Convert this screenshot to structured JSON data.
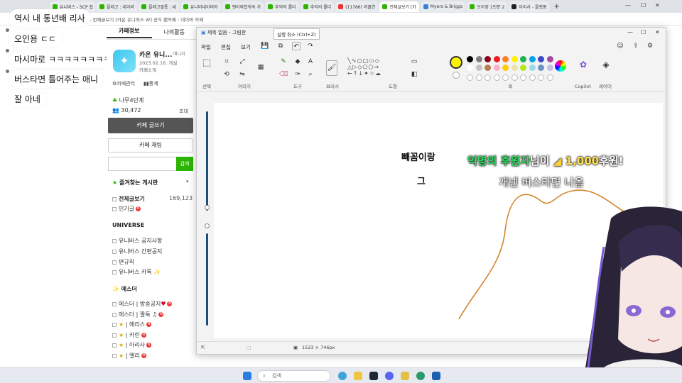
{
  "browser": {
    "tabs": [
      {
        "label": "유니버스 - SCP 잡",
        "icon": "naver-cafe-icon"
      },
      {
        "label": "플레고 : 네이버",
        "icon": "naver-cafe-icon"
      },
      {
        "label": "플레고필통 : 네",
        "icon": "naver-cafe-icon"
      },
      {
        "label": "유니버네이버의",
        "icon": "naver-cafe-icon"
      },
      {
        "label": "멘아와합작속 가",
        "icon": "naver-cafe-icon"
      },
      {
        "label": "추억의 롤더",
        "icon": "naver-cafe-icon"
      },
      {
        "label": "추억의 롤더",
        "icon": "naver-cafe-icon"
      },
      {
        "label": "(11766) 과몰연",
        "icon": "youtube-icon"
      },
      {
        "label": "전체글보기 [카",
        "icon": "naver-cafe-icon",
        "active": true
      },
      {
        "label": "Myers & Briggs",
        "icon": "globe-icon"
      },
      {
        "label": "오아정 1인분 2",
        "icon": "naver-cafe-icon"
      },
      {
        "label": "아리사 - 플랫폼",
        "icon": "chat-icon"
      }
    ],
    "address": "om 전체글보기 [카온 유니버스 W] 공식 팬카페 : 네이버 카페"
  },
  "chat": {
    "messages": [
      "역시 내 통년배 리사",
      "오인용 ㄷㄷ",
      "마시마로 ㅋㅋㅋㅋㅋㅋㅋㅋㅋ",
      "버스타면 틀어주는 애니",
      "잘 아네"
    ]
  },
  "cafe": {
    "tabs": [
      "카페정보",
      "나의활동"
    ],
    "name": "카온 유니...",
    "manager": "매니저",
    "date": "2023.02.16. 개설",
    "intro": "카페소개",
    "manage": "카페관리",
    "stats": "통계",
    "level": "나무4단계",
    "members": "30,472",
    "invite": "초대",
    "write_button": "카페 글쓰기",
    "chat_button": "카페 채팅",
    "search_button": "검색",
    "fav_header": "즐겨찾는 게시판",
    "all_posts": "전체글보기",
    "all_count": "169,123",
    "popular": "인기글",
    "universe_header": "UNIVERSE",
    "universe_items": [
      "유니버스 공지사항",
      "유니버스 간편공지",
      "편규칙",
      "유니버스 카톡"
    ],
    "esther_header": "에스더",
    "esther_items": [
      "에스더 | 방송공지",
      "에스더 | 짤툭",
      "| 에리스",
      "| 카린",
      "| 아리사",
      "| 엘리"
    ]
  },
  "paint": {
    "title": "제목 없음 - 그림판",
    "tooltip": "실행 취소 (Ctrl+Z)",
    "menu": [
      "파일",
      "편집",
      "보기"
    ],
    "groups": [
      "선택",
      "이미지",
      "도구",
      "브러시",
      "도형",
      "색",
      "Copilot",
      "레이어"
    ],
    "canvas_texts": [
      "빼꼼이랑",
      "그"
    ],
    "status_size": "1523 × 746px",
    "palette": [
      "#000000",
      "#7f7f7f",
      "#880015",
      "#ed1c24",
      "#ff7f27",
      "#fff200",
      "#22b14c",
      "#00a2e8",
      "#3f48cc",
      "#a349a4",
      "#ffffff",
      "#c3c3c3",
      "#b97a57",
      "#ffaec9",
      "#ffc90e",
      "#efe4b0",
      "#b5e61d",
      "#99d9ea",
      "#7092be",
      "#c8bfe7"
    ],
    "selected_color": "#fff200"
  },
  "donation": {
    "name": "익명의 후원자",
    "suffix": "님이",
    "amount": "1,000",
    "won": "후원!",
    "message": "개넨 버스타면 나옴"
  },
  "taskbar": {
    "search_placeholder": "검색"
  }
}
